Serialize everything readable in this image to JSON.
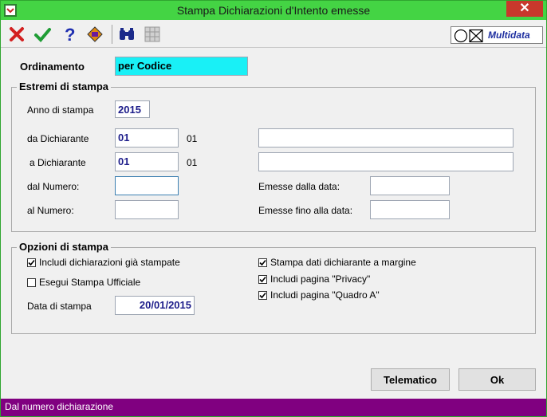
{
  "window": {
    "title": "Stampa Dichiarazioni d'Intento emesse",
    "close_label": "✕"
  },
  "toolbar": {
    "brand": "Multidata"
  },
  "ordinamento": {
    "label": "Ordinamento",
    "value": "per Codice"
  },
  "estremi": {
    "title": "Estremi di stampa",
    "anno_label": "Anno di stampa",
    "anno_value": "2015",
    "da_label": "da Dichiarante",
    "da_code": "01",
    "da_desc_code": "01",
    "da_name": "",
    "a_label": "a Dichiarante",
    "a_code": "01",
    "a_desc_code": "01",
    "a_name": "",
    "dal_numero_label": "dal Numero:",
    "dal_numero_value": "",
    "al_numero_label": "al Numero:",
    "al_numero_value": "",
    "emesse_dalla_label": "Emesse dalla data:",
    "emesse_dalla_value": "",
    "emesse_fino_label": "Emesse fino alla data:",
    "emesse_fino_value": ""
  },
  "opzioni": {
    "title": "Opzioni di stampa",
    "includi_stampate": {
      "label": "Includi dichiarazioni già stampate",
      "checked": true
    },
    "esegui_ufficiale": {
      "label": "Esegui Stampa Ufficiale",
      "checked": false
    },
    "data_label": "Data di stampa",
    "data_value": "20/01/2015",
    "margine": {
      "label": "Stampa dati dichiarante a margine",
      "checked": true
    },
    "privacy": {
      "label": "Includi pagina \"Privacy\"",
      "checked": true
    },
    "quadro_a": {
      "label": "Includi pagina \"Quadro A\"",
      "checked": true
    }
  },
  "buttons": {
    "telematico": "Telematico",
    "ok": "Ok"
  },
  "status": {
    "text": "Dal numero dichiarazione"
  }
}
